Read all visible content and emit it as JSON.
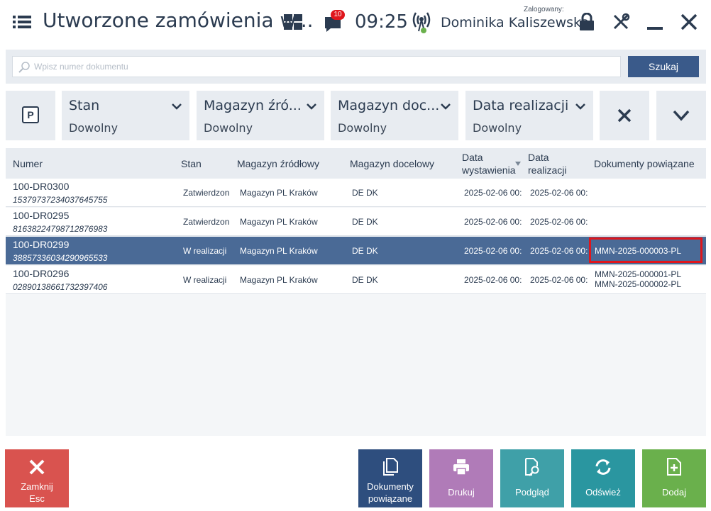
{
  "header": {
    "title": "Utworzone zamówienia w...",
    "notification_count": "10",
    "time": "09:25",
    "logged_label": "Zalogowany:",
    "user_name": "Dominika Kaliszewska"
  },
  "search": {
    "placeholder": "Wpisz numer dokumentu",
    "value": "",
    "button_label": "Szukaj"
  },
  "filters": [
    {
      "label": "Stan",
      "value": "Dowolny"
    },
    {
      "label": "Magazyn źró...",
      "value": "Dowolny"
    },
    {
      "label": "Magazyn doc...",
      "value": "Dowolny"
    },
    {
      "label": "Data realizacji",
      "value": "Dowolny"
    }
  ],
  "table": {
    "headers": {
      "numer": "Numer",
      "stan": "Stan",
      "mag_zrodlowy": "Magazyn źródłowy",
      "mag_docelowy": "Magazyn docelowy",
      "data_wyst_1": "Data",
      "data_wyst_2": "wystawienia",
      "data_real_1": "Data",
      "data_real_2": "realizacji",
      "dokumenty": "Dokumenty powiązane"
    },
    "rows": [
      {
        "numer": "100-DR0300",
        "kod": "15379737234037645755",
        "stan": "Zatwierdzon",
        "mag_zrodlowy": "Magazyn PL Kraków",
        "mag_docelowy": "DE DK",
        "data_wyst": "2025-02-06 00:",
        "data_real": "2025-02-06 00:",
        "docs": [
          ""
        ]
      },
      {
        "numer": "100-DR0295",
        "kod": "81638224798712876983",
        "stan": "Zatwierdzon",
        "mag_zrodlowy": "Magazyn PL Kraków",
        "mag_docelowy": "DE DK",
        "data_wyst": "2025-02-06 00:",
        "data_real": "2025-02-06 00:",
        "docs": [
          ""
        ]
      },
      {
        "numer": "100-DR0299",
        "kod": "38857336034290965533",
        "stan": "W realizacji",
        "mag_zrodlowy": "Magazyn PL Kraków",
        "mag_docelowy": "DE DK",
        "data_wyst": "2025-02-06 00:",
        "data_real": "2025-02-06 00:",
        "docs": [
          "MMN-2025-000003-PL"
        ]
      },
      {
        "numer": "100-DR0296",
        "kod": "02890138661732397406",
        "stan": "W realizacji",
        "mag_zrodlowy": "Magazyn PL Kraków",
        "mag_docelowy": "DE DK",
        "data_wyst": "2025-02-06 00:",
        "data_real": "2025-02-06 00:",
        "docs": [
          "MMN-2025-000001-PL",
          "MMN-2025-000002-PL"
        ]
      }
    ]
  },
  "buttons": {
    "close_1": "Zamknij",
    "close_2": "Esc",
    "docs_1": "Dokumenty",
    "docs_2": "powiązane",
    "print": "Drukuj",
    "preview": "Podgląd",
    "refresh": "Odśwież",
    "add": "Dodaj"
  },
  "colors": {
    "accent": "#3a5a8a",
    "selected_row": "#4a6a96",
    "highlight": "#e0161c",
    "close": "#d9534f",
    "docs": "#2e4e7e",
    "print": "#b07bb8",
    "preview": "#3fa0a8",
    "refresh": "#2a96a0",
    "add": "#6ab04c"
  }
}
